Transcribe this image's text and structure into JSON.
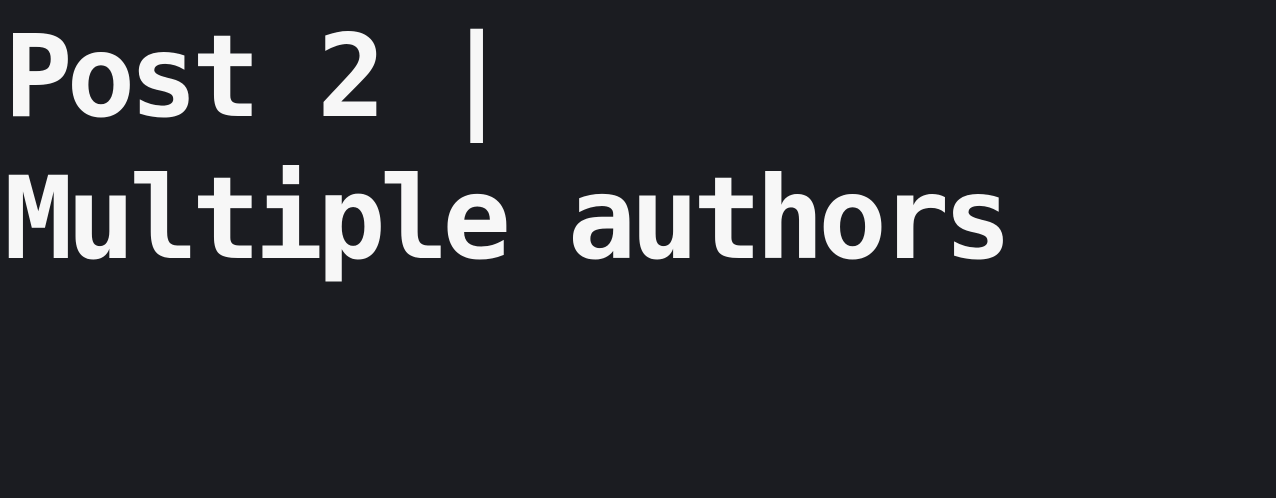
{
  "post": {
    "title_line_1": "Post 2 |",
    "title_line_2": "Multiple authors"
  },
  "colors": {
    "background": "#1b1c21",
    "text": "#f7f7f7"
  }
}
